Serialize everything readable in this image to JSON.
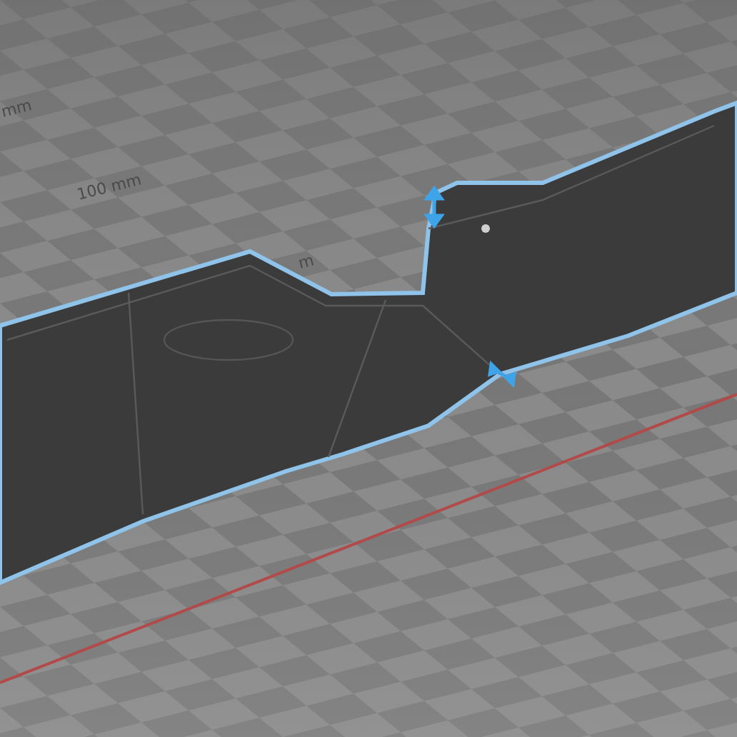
{
  "viewport": {
    "grid_labels": [
      {
        "text": "mm"
      },
      {
        "text": "100 mm"
      },
      {
        "text": "m"
      }
    ]
  }
}
